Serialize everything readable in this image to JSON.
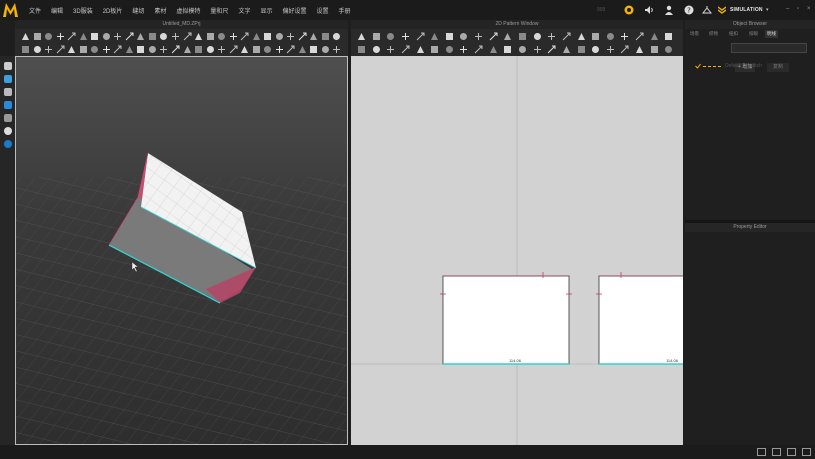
{
  "app": {
    "logo_letter": "M"
  },
  "menu": {
    "items": [
      "文件",
      "编辑",
      "3D服装",
      "2D板片",
      "缝纫",
      "素材",
      "虚拟模特",
      "量和尺",
      "文字",
      "显示",
      "偏好设置",
      "设置",
      "手册"
    ]
  },
  "ribbon": {
    "left_text": "999",
    "simulation_label": "SIMULATION"
  },
  "panels": {
    "viewport3d_title": "Untitled_MD.ZPrj",
    "viewport2d_title": "2D Pattern Window",
    "object_browser_title": "Object Browser",
    "property_editor_title": "Property Editor"
  },
  "object_browser": {
    "tabs": [
      "场景",
      "织物",
      "纽扣",
      "扣眼",
      "明线"
    ],
    "active_tab": 4,
    "add_button": "+ 增加",
    "secondary_button": "复制",
    "tree_item": "Default Topstitch"
  },
  "pattern2d": {
    "left_pattern_label": "114.06",
    "right_pattern_label": "114.06"
  },
  "status": {
    "text": ""
  },
  "colors": {
    "accent": "#f5b400",
    "seam": "#33d1d1",
    "outline": "#c8366e"
  }
}
